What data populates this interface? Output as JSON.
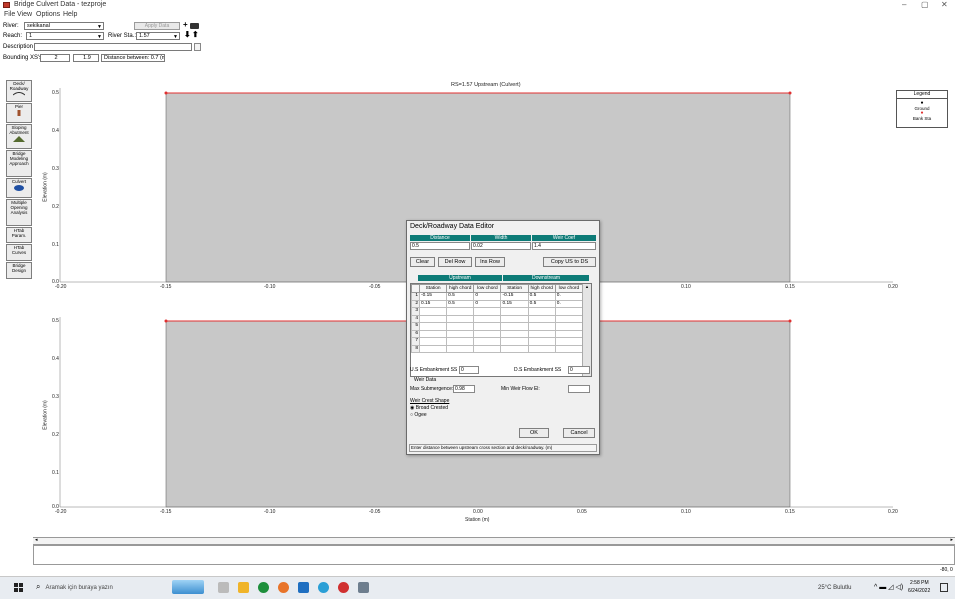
{
  "window": {
    "title": "Bridge Culvert Data - tezproje",
    "minimize": "–",
    "maximize": "▢",
    "close": "✕"
  },
  "menu": [
    "File",
    "View",
    "Options",
    "Help"
  ],
  "header": {
    "river_label": "River:",
    "river_value": "sekikanal",
    "apply_label": "Apply Data",
    "reach_label": "Reach:",
    "reach_value": "1",
    "river_sta_label": "River Sta.:",
    "river_sta_value": "1.57",
    "description_label": "Description",
    "bounding_label": "Bounding XS's",
    "bounding_xs1": "2",
    "bounding_xs2": "1.9",
    "distance_between": "Distance between: 0.7 (m)"
  },
  "left_toolbar": [
    {
      "label": "Deck/ Roadway"
    },
    {
      "label": "Pier"
    },
    {
      "label": "Sloping Abutment"
    },
    {
      "label": "Bridge Modeling Approach"
    },
    {
      "label": "Culvert"
    },
    {
      "label": "Multiple Opening Analysis"
    },
    {
      "label": "HTab Param."
    },
    {
      "label": "HTab Curves"
    },
    {
      "label": "Bridge Design"
    }
  ],
  "plot": {
    "title": "RS=1.57  Upstream (Culvert)",
    "ylabel": "Elevation (m)",
    "xlabel": "Station (m)",
    "yticks": [
      "0.5",
      "0.4",
      "0.3",
      "0.2",
      "0.1",
      "0.0"
    ],
    "xticks": [
      "-0.20",
      "-0.15",
      "-0.10",
      "-0.05",
      "0.00",
      "0.05",
      "0.10",
      "0.15",
      "0.20"
    ],
    "ground_color": "#c8c8c8",
    "bank_color": "#e03030"
  },
  "legend": {
    "title": "Legend",
    "items": [
      "Ground",
      "Bank Sta"
    ]
  },
  "dialog": {
    "title": "Deck/Roadway Data Editor",
    "col_distance": "Distance",
    "col_width": "Width",
    "col_weir": "Weir Coef",
    "distance": "0.5",
    "width": "0.02",
    "weir_coef": "1.4",
    "btn_clear": "Clear",
    "btn_del_row": "Del Row",
    "btn_ins_row": "Ins Row",
    "btn_copy": "Copy US to DS",
    "upstream": "Upstream",
    "downstream": "Downstream",
    "grid_headers": [
      "Station",
      "high chord",
      "low chord",
      "Station",
      "high chord",
      "low chord"
    ],
    "rows": [
      [
        "1",
        "-0.15",
        "0.5",
        "0",
        "-0.15",
        "0.5",
        "0."
      ],
      [
        "2",
        "0.15",
        "0.5",
        "0",
        "0.15",
        "0.5",
        "0."
      ],
      [
        "3",
        "",
        "",
        "",
        "",
        "",
        ""
      ],
      [
        "4",
        "",
        "",
        "",
        "",
        "",
        ""
      ],
      [
        "5",
        "",
        "",
        "",
        "",
        "",
        ""
      ],
      [
        "6",
        "",
        "",
        "",
        "",
        "",
        ""
      ],
      [
        "7",
        "",
        "",
        "",
        "",
        "",
        ""
      ],
      [
        "8",
        "",
        "",
        "",
        "",
        "",
        ""
      ]
    ],
    "us_embankment_label": "U.S Embankment SS",
    "us_embankment": "0",
    "ds_embankment_label": "D.S Embankment SS",
    "ds_embankment": "0",
    "weir_data": "Weir Data",
    "max_sub_label": "Max Submergence:",
    "max_sub": "0.98",
    "min_weir_label": "Min Weir Flow El:",
    "min_weir": "",
    "weir_shape": "Weir Crest Shape",
    "broad_crested": "Broad Crested",
    "ogee": "Ogee",
    "btn_ok": "OK",
    "btn_cancel": "Cancel",
    "status": "Enter distance between upstream cross section and deck/roadway. (m)"
  },
  "bottom_panel": {
    "coord": "-80, 0"
  },
  "taskbar": {
    "search_placeholder": "Aramak için buraya yazın",
    "weather": "25°C  Bulutlu",
    "time": "2:58 PM",
    "date": "6/24/2022"
  }
}
